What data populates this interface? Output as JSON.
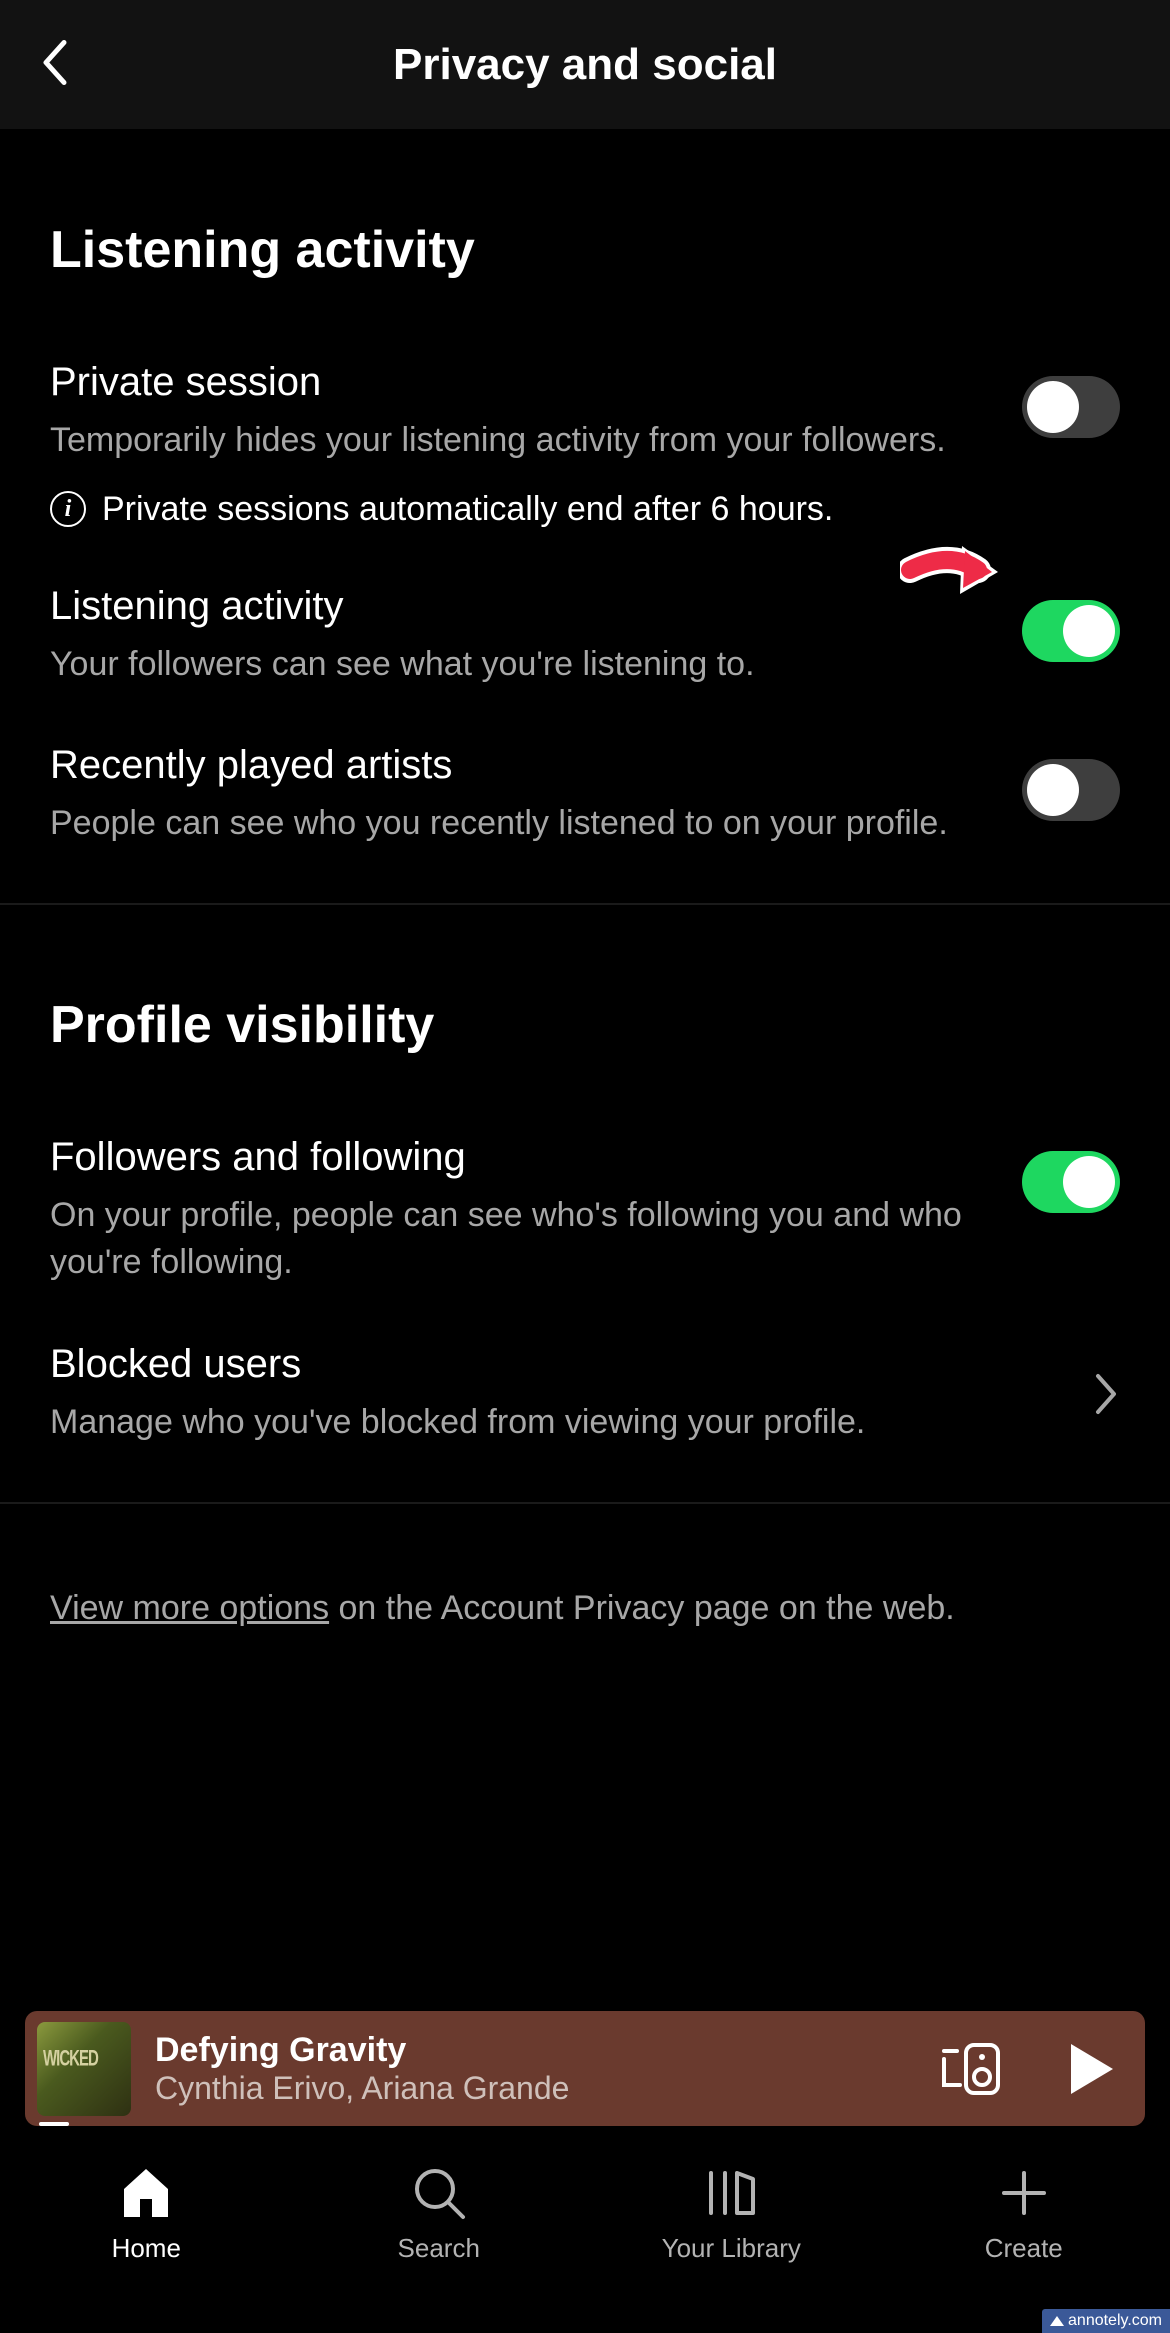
{
  "header": {
    "title": "Privacy and social"
  },
  "sections": {
    "listening": {
      "title": "Listening activity",
      "private_session": {
        "label": "Private session",
        "desc": "Temporarily hides your listening activity from your followers.",
        "info": "Private sessions automatically end after 6 hours.",
        "on": false
      },
      "listening_activity": {
        "label": "Listening activity",
        "desc": "Your followers can see what you're listening to.",
        "on": true
      },
      "recently_played": {
        "label": "Recently played artists",
        "desc": "People can see who you recently listened to on your profile.",
        "on": false
      }
    },
    "profile": {
      "title": "Profile visibility",
      "followers_following": {
        "label": "Followers and following",
        "desc": "On your profile, people can see who's following you and who you're following.",
        "on": true
      },
      "blocked": {
        "label": "Blocked users",
        "desc": "Manage who you've blocked from viewing your profile."
      }
    }
  },
  "more_options": {
    "link": "View more options",
    "rest": " on the Account Privacy page on the web."
  },
  "now_playing": {
    "title": "Defying Gravity",
    "artist": "Cynthia Erivo, Ariana Grande"
  },
  "tabs": {
    "home": "Home",
    "search": "Search",
    "library": "Your Library",
    "create": "Create"
  },
  "watermark": "annotely.com",
  "colors": {
    "accent": "#1ed760",
    "now_playing_bg": "#6a3a2e"
  }
}
